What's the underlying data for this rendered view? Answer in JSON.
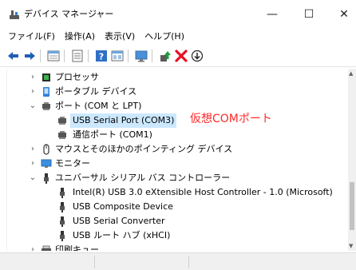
{
  "window": {
    "title": "デバイス マネージャー",
    "minimize": "—",
    "maximize": "☐",
    "close": "✕"
  },
  "menu": {
    "items": [
      "ファイル(F)",
      "操作(A)",
      "表示(V)",
      "ヘルプ(H)"
    ]
  },
  "toolbar": {
    "icons": [
      "back-icon",
      "forward-icon",
      "properties-icon",
      "details-icon",
      "help-icon",
      "view-icon",
      "monitor-icon",
      "update-driver-icon",
      "uninstall-icon",
      "download-icon"
    ]
  },
  "tree": {
    "rows": [
      {
        "label": "プロセッサ",
        "icon": "processor-icon",
        "state": "collapsed",
        "level": 1
      },
      {
        "label": "ポータブル デバイス",
        "icon": "portable-device-icon",
        "state": "collapsed",
        "level": 1
      },
      {
        "label": "ポート (COM と LPT)",
        "icon": "port-icon",
        "state": "expanded",
        "level": 1
      },
      {
        "label": "USB Serial Port (COM3)",
        "icon": "port-icon",
        "state": "leaf",
        "level": 2,
        "selected": true
      },
      {
        "label": "通信ポート (COM1)",
        "icon": "port-icon",
        "state": "leaf",
        "level": 2
      },
      {
        "label": "マウスとそのほかのポインティング デバイス",
        "icon": "mouse-icon",
        "state": "collapsed",
        "level": 1
      },
      {
        "label": "モニター",
        "icon": "monitor-icon",
        "state": "collapsed",
        "level": 1
      },
      {
        "label": "ユニバーサル シリアル バス コントローラー",
        "icon": "usb-icon",
        "state": "expanded",
        "level": 1
      },
      {
        "label": "Intel(R) USB 3.0 eXtensible Host Controller - 1.0 (Microsoft)",
        "icon": "usb-icon",
        "state": "leaf",
        "level": 2
      },
      {
        "label": "USB Composite Device",
        "icon": "usb-icon",
        "state": "leaf",
        "level": 2
      },
      {
        "label": "USB Serial Converter",
        "icon": "usb-icon",
        "state": "leaf",
        "level": 2
      },
      {
        "label": "USB ルート ハブ (xHCI)",
        "icon": "usb-icon",
        "state": "leaf",
        "level": 2
      },
      {
        "label": "印刷キュー",
        "icon": "printer-icon",
        "state": "collapsed",
        "level": 1
      }
    ]
  },
  "annotation": {
    "text": "仮想COMポート",
    "color": "#ff2a2a"
  },
  "colors": {
    "selection": "#cce8ff",
    "accent_green": "#1b9e3e",
    "error_red": "#e81123"
  }
}
